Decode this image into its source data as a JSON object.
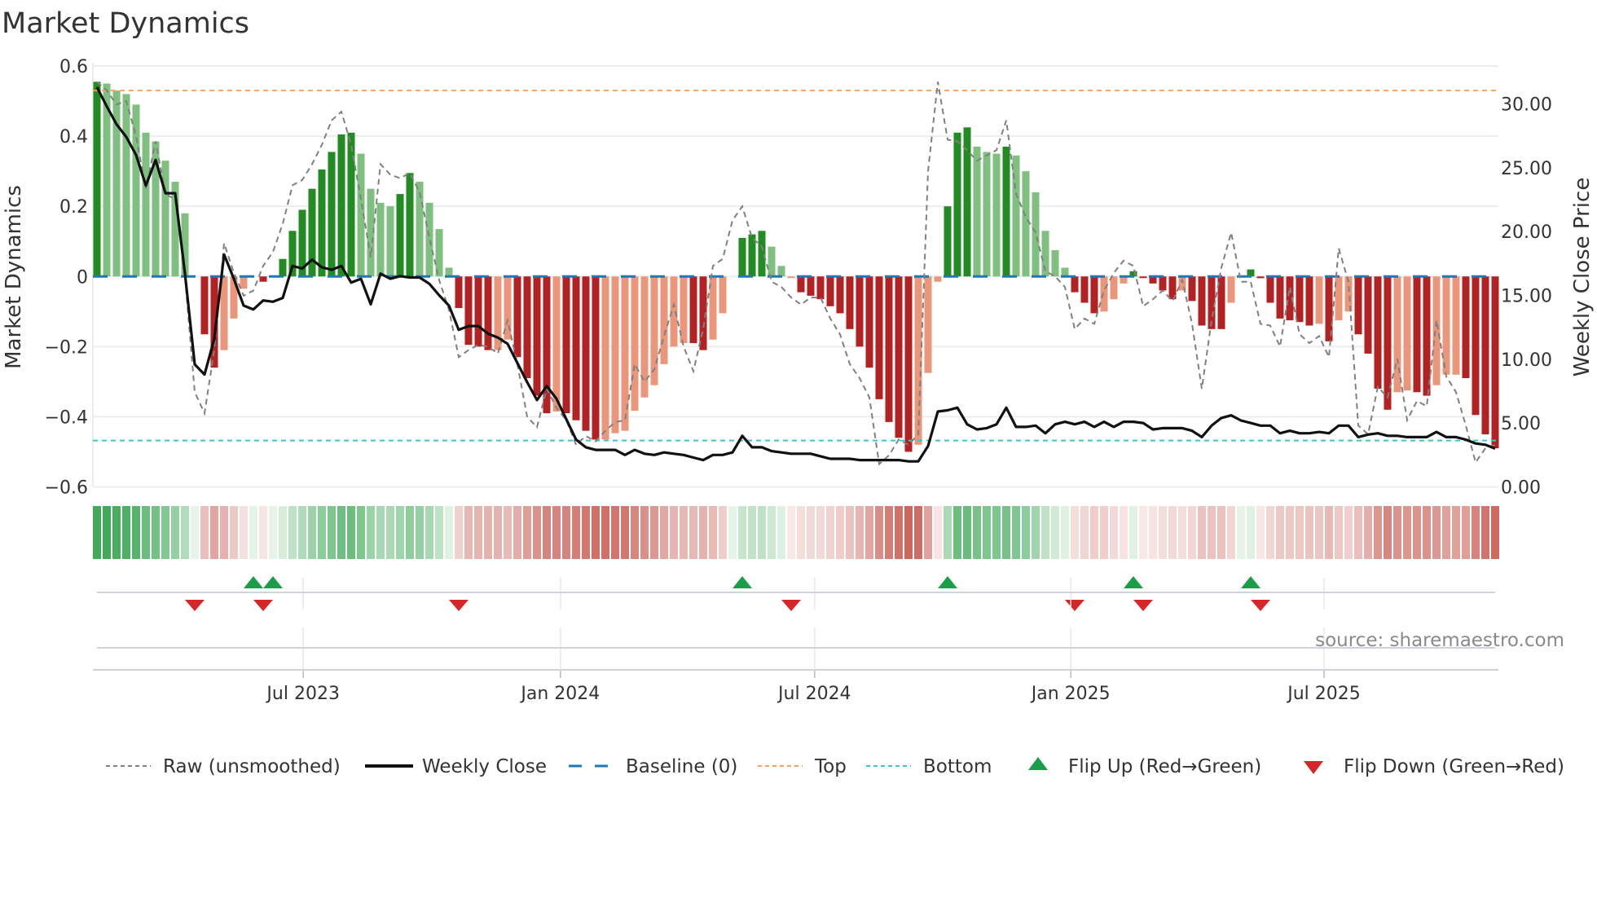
{
  "title": "Market Dynamics",
  "source": "source: sharemaestro.com",
  "chart_data": {
    "type": "bar+line",
    "title": "Market Dynamics",
    "ylabel_left": "Market Dynamics",
    "ylabel_right": "Weekly Close Price",
    "ylim_left": [
      -0.6,
      0.6
    ],
    "ylim_right": [
      0,
      33
    ],
    "left_ticks": [
      {
        "v": 0.6,
        "label": "0.6"
      },
      {
        "v": 0.4,
        "label": "0.4"
      },
      {
        "v": 0.2,
        "label": "0.2"
      },
      {
        "v": 0,
        "label": "0"
      },
      {
        "v": -0.2,
        "label": "−0.2"
      },
      {
        "v": -0.4,
        "label": "−0.4"
      },
      {
        "v": -0.6,
        "label": "−0.6"
      }
    ],
    "right_ticks": [
      {
        "v": 30,
        "label": "30.00"
      },
      {
        "v": 25,
        "label": "25.00"
      },
      {
        "v": 20,
        "label": "20.00"
      },
      {
        "v": 15,
        "label": "15.00"
      },
      {
        "v": 10,
        "label": "10.00"
      },
      {
        "v": 5,
        "label": "5.00"
      },
      {
        "v": 0,
        "label": "0.00"
      }
    ],
    "x_ticks": [
      {
        "week": 22.1,
        "label": "Jul 2023"
      },
      {
        "week": 48.4,
        "label": "Jan 2024"
      },
      {
        "week": 74.4,
        "label": "Jul 2024"
      },
      {
        "week": 100.6,
        "label": "Jan 2025"
      },
      {
        "week": 126.5,
        "label": "Jul 2025"
      }
    ],
    "x_unit": "week index (weekly bars, Feb 2023 – Oct 2025)",
    "levels": {
      "baseline": 0,
      "top": 0.53,
      "bottom": -0.468
    },
    "bars": {
      "values": [
        0.555,
        0.55,
        0.53,
        0.52,
        0.49,
        0.41,
        0.385,
        0.33,
        0.27,
        0.18,
        0,
        -0.165,
        -0.26,
        -0.21,
        -0.12,
        -0.035,
        0,
        -0.015,
        0,
        0.05,
        0.13,
        0.19,
        0.25,
        0.305,
        0.355,
        0.405,
        0.41,
        0.35,
        0.25,
        0.21,
        0.2,
        0.235,
        0.295,
        0.27,
        0.21,
        0.135,
        0.025,
        -0.09,
        -0.195,
        -0.2,
        -0.21,
        -0.21,
        -0.18,
        -0.23,
        -0.29,
        -0.34,
        -0.39,
        -0.385,
        -0.39,
        -0.41,
        -0.44,
        -0.465,
        -0.465,
        -0.447,
        -0.44,
        -0.383,
        -0.345,
        -0.31,
        -0.25,
        -0.2,
        -0.19,
        -0.19,
        -0.21,
        -0.18,
        -0.105,
        0,
        0.11,
        0.12,
        0.13,
        0.085,
        0.03,
        -0.003,
        -0.045,
        -0.055,
        -0.065,
        -0.085,
        -0.105,
        -0.15,
        -0.2,
        -0.26,
        -0.35,
        -0.415,
        -0.46,
        -0.5,
        -0.48,
        -0.275,
        -0.015,
        0.2,
        0.41,
        0.425,
        0.37,
        0.355,
        0.35,
        0.37,
        0.345,
        0.3,
        0.24,
        0.13,
        0.075,
        0.025,
        -0.045,
        -0.075,
        -0.105,
        -0.1,
        -0.065,
        -0.02,
        0.015,
        -0.002,
        -0.02,
        -0.04,
        -0.065,
        -0.04,
        -0.07,
        -0.14,
        -0.15,
        -0.15,
        -0.075,
        0,
        0.02,
        -0.005,
        -0.075,
        -0.12,
        -0.125,
        -0.13,
        -0.14,
        -0.135,
        -0.185,
        -0.125,
        -0.1,
        -0.165,
        -0.22,
        -0.32,
        -0.38,
        -0.33,
        -0.325,
        -0.33,
        -0.34,
        -0.31,
        -0.28,
        -0.28,
        -0.29,
        -0.395,
        -0.45,
        -0.49
      ],
      "strong": "100000000001100001011111111000011000011110011110111100000000011000111000111111111111000111000100000011100011111011110011111110100111100110001111"
    },
    "raw": [
      0.555,
      0.53,
      0.49,
      0.5,
      0.4,
      0.25,
      0.385,
      0.235,
      0.22,
      0,
      -0.33,
      -0.39,
      -0.21,
      0.095,
      0.01,
      -0.055,
      -0.04,
      0.03,
      0.07,
      0.15,
      0.26,
      0.275,
      0.32,
      0.375,
      0.445,
      0.47,
      0.375,
      0.22,
      0.055,
      0.32,
      0.29,
      0.28,
      0.295,
      0.24,
      0.11,
      -0.01,
      -0.095,
      -0.23,
      -0.21,
      -0.195,
      -0.2,
      -0.22,
      -0.125,
      -0.25,
      -0.4,
      -0.43,
      -0.32,
      -0.375,
      -0.41,
      -0.48,
      -0.455,
      -0.47,
      -0.44,
      -0.415,
      -0.41,
      -0.25,
      -0.3,
      -0.265,
      -0.17,
      -0.08,
      -0.2,
      -0.27,
      -0.15,
      0.03,
      0.05,
      0.16,
      0.2,
      0.11,
      0.085,
      -0.015,
      -0.03,
      -0.06,
      -0.08,
      -0.06,
      -0.06,
      -0.12,
      -0.165,
      -0.25,
      -0.29,
      -0.345,
      -0.535,
      -0.51,
      -0.465,
      -0.48,
      -0.45,
      0.3,
      0.555,
      0.39,
      0.385,
      0.36,
      0.33,
      0.345,
      0.36,
      0.445,
      0.235,
      0.17,
      0.125,
      0.015,
      0,
      -0.03,
      -0.15,
      -0.12,
      -0.135,
      -0.04,
      0.01,
      0.045,
      0.03,
      -0.085,
      -0.065,
      -0.04,
      -0.07,
      -0.01,
      -0.135,
      -0.32,
      -0.125,
      0.025,
      0.125,
      -0.015,
      -0.015,
      -0.135,
      -0.14,
      -0.2,
      -0.03,
      -0.165,
      -0.19,
      -0.17,
      -0.23,
      0.08,
      -0.015,
      -0.425,
      -0.45,
      -0.315,
      -0.345,
      -0.235,
      -0.41,
      -0.355,
      -0.37,
      -0.125,
      -0.285,
      -0.33,
      -0.425,
      -0.53,
      -0.49,
      -0.48
    ],
    "close": [
      31.3,
      29.8,
      28.4,
      27.4,
      26.0,
      23.6,
      25.6,
      23.0,
      23.0,
      16.7,
      9.6,
      8.8,
      11.6,
      18.2,
      16.3,
      14.2,
      13.9,
      14.6,
      14.5,
      14.8,
      17.3,
      17.1,
      17.8,
      17.2,
      17.0,
      17.3,
      16.0,
      16.3,
      14.3,
      16.7,
      16.3,
      16.5,
      16.4,
      16.4,
      15.9,
      15.0,
      14.2,
      12.3,
      12.6,
      12.6,
      12.0,
      11.7,
      11.2,
      9.7,
      8.2,
      6.8,
      7.9,
      6.9,
      5.3,
      3.7,
      3.1,
      2.9,
      2.9,
      2.9,
      2.5,
      2.9,
      2.6,
      2.5,
      2.7,
      2.6,
      2.5,
      2.3,
      2.1,
      2.5,
      2.5,
      2.7,
      4.0,
      3.1,
      3.1,
      2.8,
      2.7,
      2.6,
      2.6,
      2.6,
      2.4,
      2.2,
      2.2,
      2.2,
      2.1,
      2.1,
      2.1,
      2.1,
      2.1,
      2.0,
      2.0,
      3.2,
      5.9,
      6.0,
      6.2,
      4.9,
      4.5,
      4.6,
      4.9,
      6.2,
      4.7,
      4.7,
      4.8,
      4.2,
      4.9,
      5.1,
      4.9,
      5.1,
      4.7,
      5.1,
      4.7,
      5.1,
      5.1,
      5.0,
      4.5,
      4.6,
      4.6,
      4.6,
      4.4,
      3.9,
      4.8,
      5.4,
      5.6,
      5.2,
      5.0,
      4.8,
      4.8,
      4.2,
      4.4,
      4.2,
      4.2,
      4.3,
      4.2,
      4.8,
      4.8,
      3.9,
      4.1,
      4.2,
      4.0,
      4.0,
      3.9,
      3.9,
      3.9,
      4.3,
      3.9,
      3.9,
      3.7,
      3.4,
      3.3,
      3.0
    ],
    "flip_up_weeks": [
      17,
      19,
      67,
      88,
      107,
      119
    ],
    "flip_down_weeks": [
      11,
      18,
      38,
      72,
      101,
      108,
      120
    ],
    "legend": {
      "placement": "bottom",
      "items": [
        {
          "key": "raw",
          "label": "Raw (unsmoothed)"
        },
        {
          "key": "close",
          "label": "Weekly Close"
        },
        {
          "key": "baseline",
          "label": "Baseline (0)"
        },
        {
          "key": "top",
          "label": "Top"
        },
        {
          "key": "bottom",
          "label": "Bottom"
        },
        {
          "key": "flipup",
          "label": "Flip Up (Red→Green)"
        },
        {
          "key": "flipdown",
          "label": "Flip Down (Green→Red)"
        }
      ]
    },
    "colors": {
      "pos_strong": "#228b22",
      "pos_weak": "#7fbf7f",
      "neg_strong": "#b22222",
      "neg_weak": "#e9967a",
      "raw": "#808080",
      "close": "#111111",
      "baseline": "#1f77b4",
      "top": "#f4a460",
      "bottom": "#3cc4d4",
      "flip_up": "#1a9e4a",
      "flip_down": "#d62728",
      "strip_pos": "#2ca046",
      "strip_neg": "#c0463c",
      "grid": "#ebedf0"
    }
  }
}
